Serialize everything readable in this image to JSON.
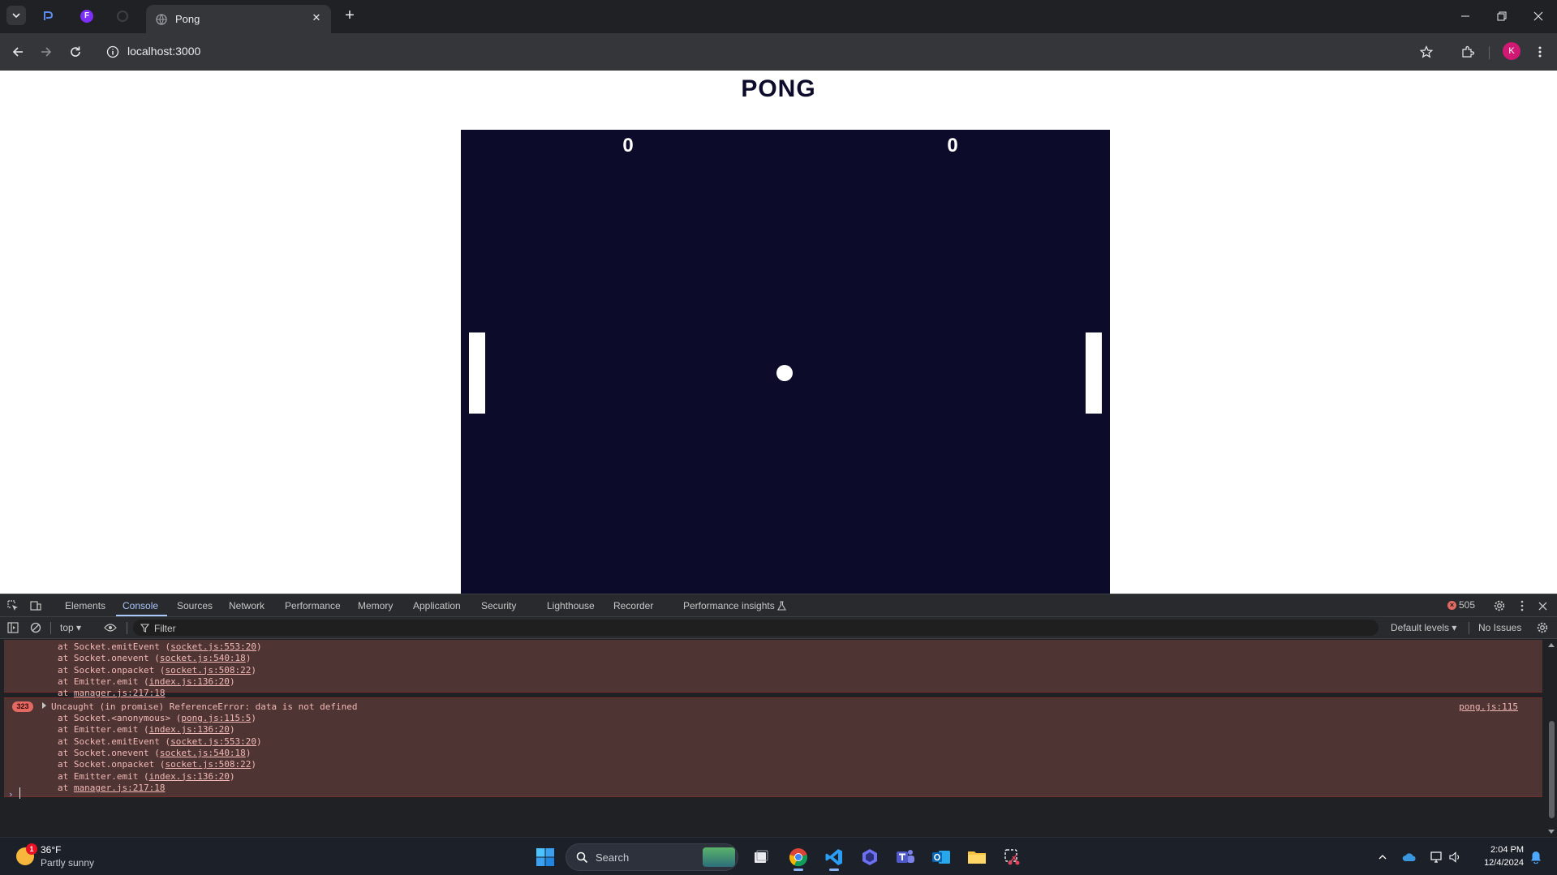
{
  "browser": {
    "active_tab_title": "Pong",
    "url": "localhost:3000",
    "avatar_letter": "K"
  },
  "page": {
    "title": "PONG",
    "score_left": "0",
    "score_right": "0",
    "colors": {
      "court": "#0d0b2a",
      "paddle": "#ffffff",
      "ball": "#ffffff"
    }
  },
  "devtools": {
    "tabs": [
      "Elements",
      "Console",
      "Sources",
      "Network",
      "Performance",
      "Memory",
      "Application",
      "Security",
      "Lighthouse",
      "Recorder",
      "Performance insights"
    ],
    "active_tab": "Console",
    "error_count": "505",
    "context": "top",
    "filter_placeholder": "Filter",
    "levels": "Default levels",
    "issues": "No Issues",
    "console": {
      "first_block": [
        "at Socket.emitEvent (|socket.js:553:20|)",
        "at Socket.onevent (|socket.js:540:18|)",
        "at Socket.onpacket (|socket.js:508:22|)",
        "at Emitter.emit (|index.js:136:20|)",
        "at |manager.js:217:18|"
      ],
      "error": {
        "count": "323",
        "message": "Uncaught (in promise) ReferenceError: data is not defined",
        "source": "pong.js:115",
        "trace": [
          "at Socket.<anonymous> (|pong.js:115:5|)",
          "at Emitter.emit (|index.js:136:20|)",
          "at Socket.emitEvent (|socket.js:553:20|)",
          "at Socket.onevent (|socket.js:540:18|)",
          "at Socket.onpacket (|socket.js:508:22|)",
          "at Emitter.emit (|index.js:136:20|)",
          "at |manager.js:217:18|"
        ]
      }
    }
  },
  "taskbar": {
    "weather_temp": "36°F",
    "weather_condition": "Partly sunny",
    "weather_badge": "1",
    "search_label": "Search",
    "time": "2:04 PM",
    "date": "12/4/2024"
  }
}
